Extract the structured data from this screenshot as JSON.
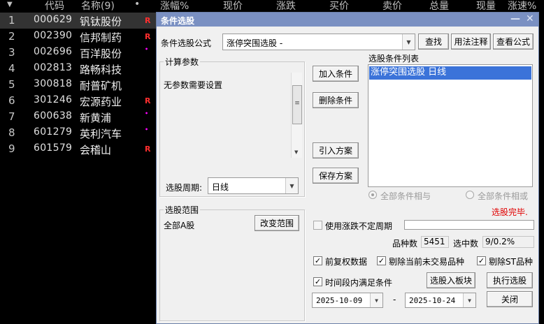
{
  "grid": {
    "header": {
      "sort_arrow": "▼",
      "code": "代码",
      "name": "名称(9)",
      "dot": "•",
      "change_pct": "涨幅%",
      "price": "现价",
      "change": "涨跌",
      "bid": "买价",
      "ask": "卖价",
      "volume": "总量",
      "cur_vol": "现量",
      "speed": "涨速%"
    },
    "rows": [
      {
        "n": "1",
        "code": "000629",
        "name": "钒钛股份",
        "mark": "R"
      },
      {
        "n": "2",
        "code": "002390",
        "name": "信邦制药",
        "mark": "R"
      },
      {
        "n": "3",
        "code": "002696",
        "name": "百洋股份",
        "mark": "•"
      },
      {
        "n": "4",
        "code": "002813",
        "name": "路畅科技",
        "mark": ""
      },
      {
        "n": "5",
        "code": "300818",
        "name": "耐普矿机",
        "mark": ""
      },
      {
        "n": "6",
        "code": "301246",
        "name": "宏源药业",
        "mark": "R"
      },
      {
        "n": "7",
        "code": "600638",
        "name": "新黄浦",
        "mark": "•"
      },
      {
        "n": "8",
        "code": "601279",
        "name": "英利汽车",
        "mark": "•"
      },
      {
        "n": "9",
        "code": "601579",
        "name": "会稽山",
        "mark": "R"
      }
    ]
  },
  "dialog": {
    "title": "条件选股",
    "minimize": "—",
    "close": "✕",
    "formula_label": "条件选股公式",
    "formula_value": "涨停突围选股  -",
    "find": "查找",
    "usage": "用法注释",
    "view_formula": "查看公式",
    "calc_params": "计算参数",
    "no_params": "无参数需要设置",
    "period_label": "选股周期:",
    "period_value": "日线",
    "add_condition": "加入条件",
    "delete_condition": "删除条件",
    "import_plan": "引入方案",
    "save_plan": "保存方案",
    "condition_list_label": "选股条件列表",
    "condition_item": "涨停突围选股  日线",
    "all_and": "全部条件相与",
    "all_or": "全部条件相或",
    "status": "选股完毕.",
    "scope_label": "选股范围",
    "scope_value": "全部A股",
    "change_scope": "改变范围",
    "use_variable_period": "使用涨跌不定周期",
    "variety_count_label": "品种数",
    "variety_count": "5451",
    "selected_label": "选中数",
    "selected_value": "9/0.2%",
    "forward_adjust": "前复权数据",
    "exclude_untraded": "剔除当前未交易品种",
    "exclude_st": "剔除ST品种",
    "time_range": "时间段内满足条件",
    "to_block": "选股入板块",
    "execute": "执行选股",
    "date_from": "2025-10-09",
    "date_sep": "-",
    "date_to": "2025-10-24",
    "close_btn": "关闭",
    "check_mark": "✓"
  }
}
